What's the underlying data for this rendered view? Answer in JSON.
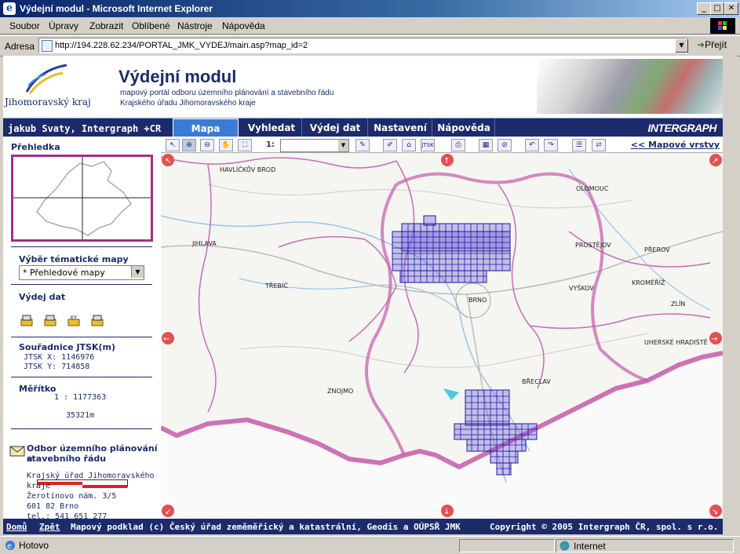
{
  "window": {
    "title": "Výdejní modul - Microsoft Internet Explorer",
    "minimize": "_",
    "maximize": "□",
    "close": "✕"
  },
  "menu": [
    "Soubor",
    "Úpravy",
    "Zobrazit",
    "Oblíbené",
    "Nástroje",
    "Nápověda"
  ],
  "address": {
    "label": "Adresa",
    "url": "http://194.228.62.234/PORTAL_JMK_VYDEJ/main.asp?map_id=2",
    "go": "Přejít"
  },
  "header": {
    "logo_text": "Jihomoravský kraj",
    "title": "Výdejní modul",
    "subtitle_1": "mapový portál odboru územního plánování a stavebního řádu",
    "subtitle_2": "Krajského úřadu Jihomoravského kraje"
  },
  "nav": {
    "user": "jakub Svaty, Intergraph +CR",
    "tabs": [
      "Mapa",
      "Vyhledat",
      "Výdej dat",
      "Nastavení",
      "Nápověda"
    ],
    "brand": "INTERGRAPH"
  },
  "left": {
    "overview_title": "Přehledka",
    "thematic_title": "Výběr tématické mapy",
    "thematic_value": "* Přehledové mapy",
    "download_title": "Výdej dat",
    "coords_title": "Souřadnice JTSK(m)",
    "jtsk_x": "JTSK X: 1146976",
    "jtsk_y": "JTSK Y: 714858",
    "scale_title": "Měřítko",
    "scale_value": "1 : 1177363",
    "scale_length": "35321m",
    "dept_title_1": "Odbor územního plánování a",
    "dept_title_2": "stavebního řádu",
    "addr_1": "Krajský úřad Jihomoravského",
    "addr_2": "kraje",
    "addr_3": "Žerotínovo nám. 3/5",
    "addr_4": "601 82 Brno",
    "addr_5": "tel.: 541 651 277"
  },
  "toolbar": {
    "scale_prefix": "1:",
    "layers_link": "<< Mapové vrstvy",
    "jtsk_btn": "JTSK"
  },
  "map": {
    "labels": [
      "HAVLÍČKŮV BROD",
      "JIHLAVA",
      "TŘEBÍČ",
      "ZNOJMO",
      "BRNO",
      "OLOMOUC",
      "PROSTĚJOV",
      "PŘEROV",
      "UHERSKÉ HRADIŠTĚ",
      "ZLÍN",
      "BŘECLAV",
      "KROMĚŘÍŽ",
      "VYŠKOV"
    ]
  },
  "footer": {
    "home": "Domů",
    "back": "Zpět",
    "copyright": "Mapový podklad (c) Český úřad zeměměřický a katastrální, Geodis a OÚPSŘ JMK",
    "intergraph": "Copyright © 2005 Intergraph ČR, spol. s r.o."
  },
  "status": {
    "left": "Hotovo",
    "zone": "Internet"
  }
}
